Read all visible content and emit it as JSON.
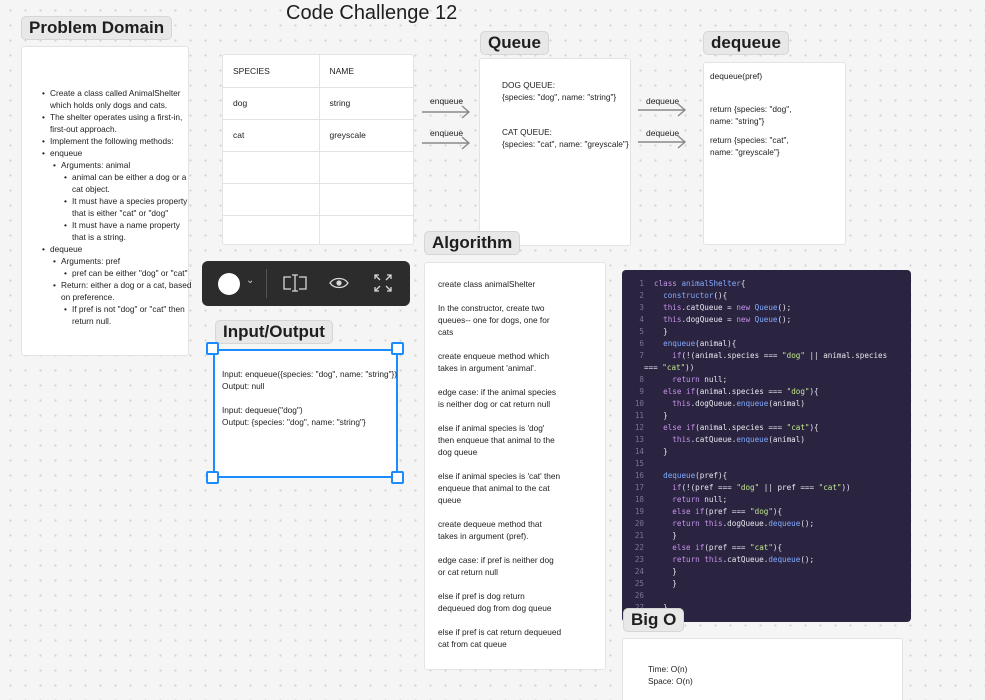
{
  "page_title": "Code Challenge 12",
  "problem_domain": {
    "title": "Problem Domain",
    "items": [
      {
        "text": "Create a class called AnimalShelter which holds only dogs and cats."
      },
      {
        "text": "The shelter operates using a first-in, first-out approach."
      },
      {
        "text": "Implement the following methods:"
      },
      {
        "text": "enqueue",
        "children": [
          {
            "text": "Arguments: animal",
            "children": [
              {
                "text": "animal can be either a dog or a cat object."
              },
              {
                "text": "It must have a species property that is either \"cat\" or \"dog\""
              },
              {
                "text": "It must have a name property that is a string."
              }
            ]
          }
        ]
      },
      {
        "text": "dequeue",
        "children": [
          {
            "text": "Arguments: pref",
            "children": [
              {
                "text": "pref can be either \"dog\" or \"cat\""
              }
            ]
          },
          {
            "text": "Return: either a dog or a cat, based on preference.",
            "children": [
              {
                "text": "If pref is not \"dog\" or \"cat\" then return null."
              }
            ]
          }
        ]
      }
    ]
  },
  "table": {
    "headers": [
      "SPECIES",
      "NAME"
    ],
    "rows": [
      [
        "dog",
        "string"
      ],
      [
        "cat",
        "greyscale"
      ],
      [
        "",
        ""
      ],
      [
        "",
        ""
      ],
      [
        "",
        ""
      ]
    ]
  },
  "arrows": {
    "enqueue_label": "enqueue",
    "dequeue_label": "dequeue"
  },
  "queue": {
    "title": "Queue",
    "dog_title": "DOG QUEUE:",
    "dog_value": "{species: \"dog\", name: \"string\"}",
    "cat_title": "CAT QUEUE:",
    "cat_value": "{species: \"cat\", name: \"greyscale\"}"
  },
  "dequeue": {
    "title": "dequeue",
    "signature": "dequeue(pref)",
    "return_dog": "return {species: \"dog\", name: \"string\"}",
    "return_cat": "return {species: \"cat\", name: \"greyscale\"}"
  },
  "io": {
    "title": "Input/Output",
    "lines": [
      "Input: enqueue({species: \"dog\", name: \"string\"})",
      "Output: null",
      "",
      "Input: dequeue(\"dog\")",
      "Output: {species: \"dog\", name: \"string\"}"
    ]
  },
  "algorithm": {
    "title": "Algorithm",
    "steps": [
      "create class animalShelter",
      "In the constructor, create two queues-- one for dogs, one for cats",
      "create enqueue method which takes in argument 'animal'.",
      "edge case: if the animal species is neither dog or cat return null",
      "else if animal species is 'dog' then enqueue that animal to the dog queue",
      "else if animal species is 'cat' then enqueue that animal to the cat queue",
      "create dequeue method that takes in argument (pref).",
      "edge case: if pref is neither dog or cat return null",
      "else if pref is dog return dequeued dog from dog queue",
      "else if pref is cat return dequeued cat from cat queue"
    ]
  },
  "code": {
    "lines": [
      "class animalShelter{",
      "  constructor(){",
      "  this.catQueue = new Queue();",
      "  this.dogQueue = new Queue();",
      "  }",
      "  enqueue(animal){",
      "    if(!(animal.species === \"dog\" || animal.species",
      "=== \"cat\"))",
      "    return null;",
      "  else if(animal.species === \"dog\"){",
      "    this.dogQueue.enqueue(animal)",
      "  }",
      "  else if(animal.species === \"cat\"){",
      "    this.catQueue.enqueue(animal)",
      "  }",
      "",
      "  dequeue(pref){",
      "    if(!(pref === \"dog\" || pref === \"cat\"))",
      "    return null;",
      "    else if(pref === \"dog\"){",
      "    return this.dogQueue.dequeue();",
      "    }",
      "    else if(pref === \"cat\"){",
      "    return this.catQueue.dequeue();",
      "    }",
      "    }",
      "",
      "  }"
    ],
    "keywords": [
      "class",
      "new",
      "return",
      "else",
      "if",
      "this"
    ],
    "functions": [
      "animalShelter",
      "constructor",
      "Queue",
      "enqueue",
      "dequeue"
    ]
  },
  "big_o": {
    "title": "Big O",
    "time": "Time: O(n)",
    "space": "Space: O(n)"
  },
  "toolbar": {
    "icons": [
      "color-swatch-icon",
      "chevron-down-icon",
      "text-frame-icon",
      "eye-icon",
      "expand-icon"
    ]
  },
  "colors": {
    "selection": "#1a8cff",
    "code_bg": "#2a2440",
    "toolbar_bg": "#2c2c2c"
  }
}
